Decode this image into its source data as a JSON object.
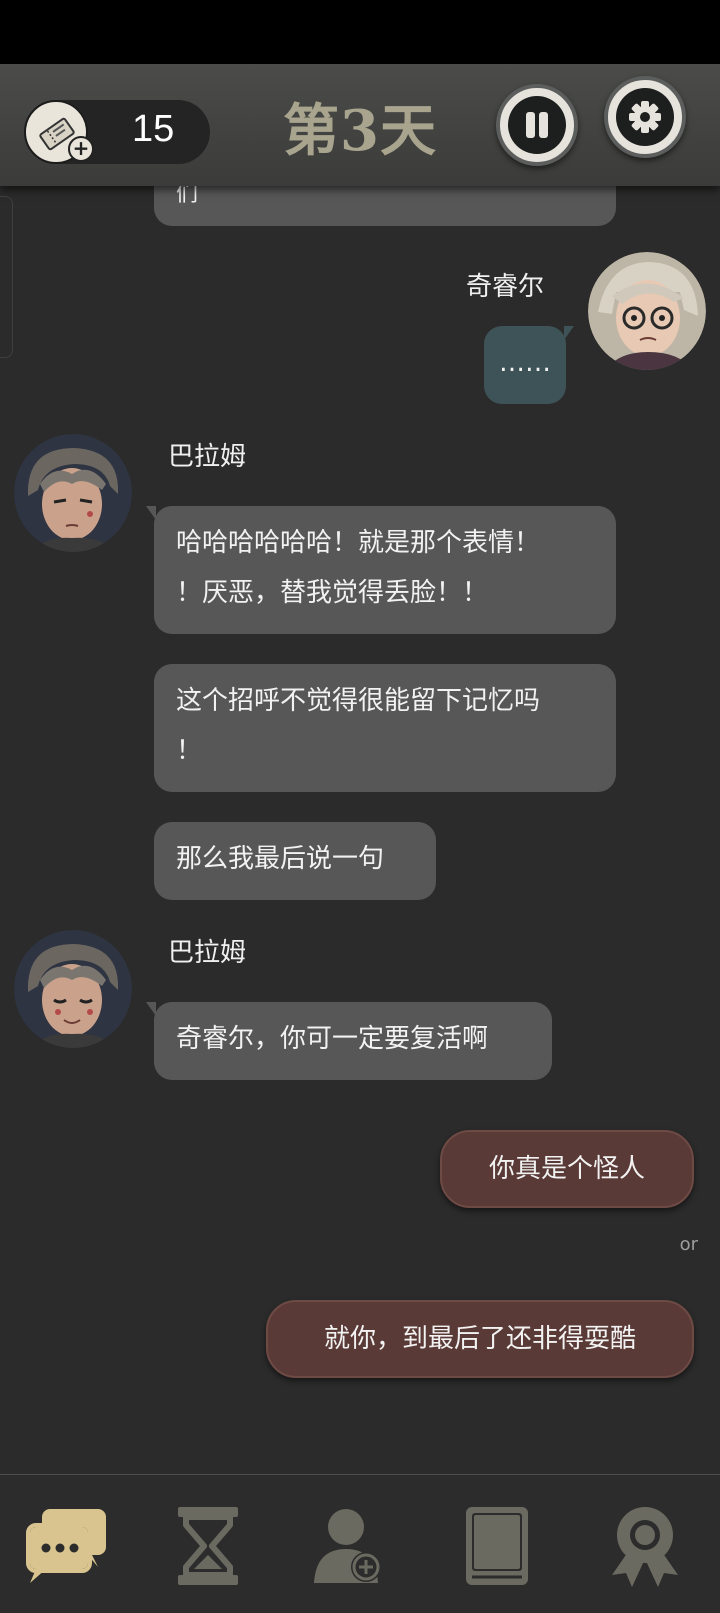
{
  "header": {
    "ticket_count": "15",
    "day_title": "第3天"
  },
  "messages": [
    {
      "type": "truncated",
      "text": "们"
    },
    {
      "type": "self",
      "name": "奇睿尔",
      "text": "……"
    },
    {
      "type": "other",
      "name": "巴拉姆",
      "texts": [
        "哈哈哈哈哈哈！就是那个表情！！厌恶，替我觉得丢脸！！",
        "这个招呼不觉得很能留下记忆吗！",
        "那么我最后说一句"
      ]
    },
    {
      "type": "other",
      "name": "巴拉姆",
      "texts": [
        "奇睿尔，你可一定要复活啊"
      ]
    }
  ],
  "bubbles": {
    "truncated": "们",
    "self_name": "奇睿尔",
    "self_msg": "……",
    "balam_name_1": "巴拉姆",
    "balam_msg_1a_line1": "哈哈哈哈哈哈！就是那个表情！",
    "balam_msg_1a_line2": "！厌恶，替我觉得丢脸！！",
    "balam_msg_1b_line1": "这个招呼不觉得很能留下记忆吗",
    "balam_msg_1b_line2": "！",
    "balam_msg_1c": "那么我最后说一句",
    "balam_name_2": "巴拉姆",
    "balam_msg_2": "奇睿尔，你可一定要复活啊"
  },
  "choices": {
    "option_1": "你真是个怪人",
    "separator": "or",
    "option_2": "就你，到最后了还非得耍酷"
  },
  "nav": {
    "items": [
      {
        "icon": "chat-icon",
        "active": true
      },
      {
        "icon": "hourglass-icon",
        "active": false
      },
      {
        "icon": "add-contact-icon",
        "active": false
      },
      {
        "icon": "book-icon",
        "active": false
      },
      {
        "icon": "badge-icon",
        "active": false
      }
    ]
  },
  "colors": {
    "background": "#2a2b2a",
    "other_bubble": "#575757",
    "self_bubble": "#3e5358",
    "choice_bubble": "#5a3a36",
    "nav_active": "#d9c48f",
    "nav_inactive": "#6b6a60",
    "day_title": "#a9a48e"
  }
}
